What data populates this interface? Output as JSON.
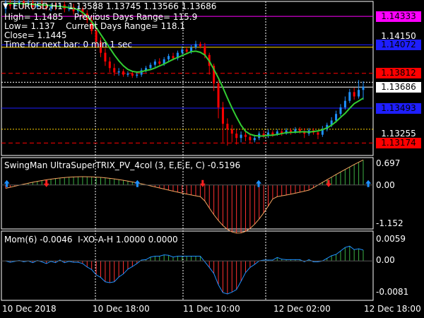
{
  "main_panel": {
    "symbol_line": "EURUSD,H1  1.13588 1.13745 1.13566 1.13686",
    "info_lines": [
      "High= 1.1485    Previous Days Range= 115.9",
      "Low= 1.137    Current Days Range= 118.1",
      "Close= 1.1445",
      "Time for next bar: 0 min 1 sec"
    ],
    "price_labels": [
      {
        "text": "1.14333",
        "bg": "#ff00ff",
        "fg": "#000000"
      },
      {
        "text": "1.14150",
        "bg": "",
        "fg": "#ffffff"
      },
      {
        "text": "1.14072",
        "bg": "#1e1eff",
        "fg": "#000000"
      },
      {
        "text": "1.13812",
        "bg": "#ff0000",
        "fg": "#000000"
      },
      {
        "text": "1.13686",
        "bg": "#ffffff",
        "fg": "#000000"
      },
      {
        "text": "1.13493",
        "bg": "#1e1eff",
        "fg": "#000000"
      },
      {
        "text": "1.13255",
        "bg": "",
        "fg": "#ffffff"
      },
      {
        "text": "1.13174",
        "bg": "#ff0000",
        "fg": "#000000"
      }
    ]
  },
  "trix_panel": {
    "title": "SwingMan UltraSuperTRIX_PV_4col (3, E,E,E, C) -0.5196",
    "scale_labels": [
      "0.697",
      "0.00",
      "-1.152"
    ]
  },
  "mom_panel": {
    "title": "Mom(6) -0.0046  I-XO-A-H 1.0000 0.0000",
    "scale_labels": [
      "0.0059",
      "0.00",
      "-0.0081"
    ]
  },
  "time_labels": [
    "10 Dec 2018",
    "10 Dec 18:00",
    "11 Dec 10:00",
    "12 Dec 02:00",
    "12 Dec 18:00"
  ],
  "colors": {
    "background": "#000000",
    "up_bar": "#1e90ff",
    "down_bar": "#ff0000",
    "moving_average": "#32cd32",
    "momentum_line": "#1e90ff"
  }
}
